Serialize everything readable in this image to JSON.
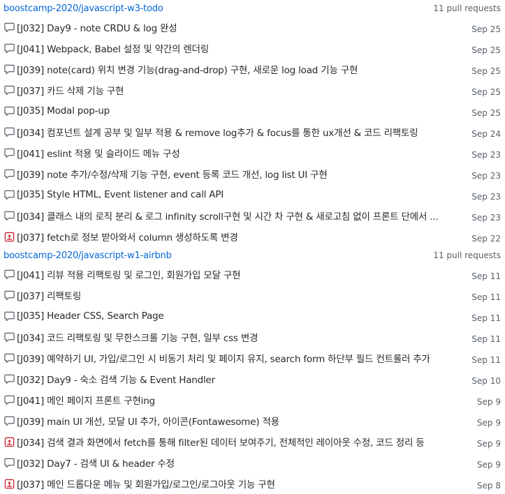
{
  "groups": [
    {
      "repo": "boostcamp-2020/javascript-w3-todo",
      "count": "11 pull requests",
      "items": [
        {
          "title": "[J032] Day9 - note CRDU & log 완성",
          "date": "Sep 25",
          "icon": "comment-icon"
        },
        {
          "title": "[J041] Webpack, Babel 설정 및 약간의 렌더링",
          "date": "Sep 25",
          "icon": "comment-icon"
        },
        {
          "title": "[J039] note(card) 위치 변경 기능(drag-and-drop) 구현, 새로운 log load 기능 구현",
          "date": "Sep 25",
          "icon": "comment-icon"
        },
        {
          "title": "[J037] 카드 삭제 기능 구현",
          "date": "Sep 25",
          "icon": "comment-icon"
        },
        {
          "title": "[J035] Modal pop-up",
          "date": "Sep 25",
          "icon": "comment-icon"
        },
        {
          "title": "[J034] 컴포넌트 설계 공부 및 일부 적용 & remove log추가 & focus를 통한 ux개선 & 코드 리팩토링",
          "date": "Sep 24",
          "icon": "comment-icon"
        },
        {
          "title": "[J041] eslint 적용 및 슬라이드 메뉴 구성",
          "date": "Sep 23",
          "icon": "comment-icon"
        },
        {
          "title": "[J039] note 추가/수정/삭제 기능 구현, event 등록 코드 개선, log list UI 구현",
          "date": "Sep 23",
          "icon": "comment-icon"
        },
        {
          "title": "[J035] Style HTML, Event listener and call API",
          "date": "Sep 23",
          "icon": "comment-icon"
        },
        {
          "title": "[J034] 클래스 내의 로직 분리 & 로그 infinity scroll구현 및 시간 차 구현 & 새로고침 없이 프론트 단에서 ...",
          "date": "Sep 23",
          "icon": "comment-icon"
        },
        {
          "title": "[J037] fetch로 정보 받아와서 column 생성하도록 변경",
          "date": "Sep 22",
          "icon": "pull-request-icon"
        }
      ]
    },
    {
      "repo": "boostcamp-2020/javascript-w1-airbnb",
      "count": "11 pull requests",
      "items": [
        {
          "title": "[J041] 리뷰 적용 리팩토링 및 로그인, 회원가입 모달 구현",
          "date": "Sep 11",
          "icon": "comment-icon"
        },
        {
          "title": "[J037] 리팩토링",
          "date": "Sep 11",
          "icon": "comment-icon"
        },
        {
          "title": "[J035] Header CSS, Search Page",
          "date": "Sep 11",
          "icon": "comment-icon"
        },
        {
          "title": "[J034] 코드 리팩토링 및 무한스크롤 기능 구현, 일부 css 변경",
          "date": "Sep 11",
          "icon": "comment-icon"
        },
        {
          "title": "[J039] 예약하기 UI, 가입/로그인 시 비동기 처리 및 페이지 유지, search form 하단부 필드 컨트롤러 추가",
          "date": "Sep 11",
          "icon": "comment-icon"
        },
        {
          "title": "[J032] Day9 - 숙소 검색 기능 & Event Handler",
          "date": "Sep 10",
          "icon": "comment-icon"
        },
        {
          "title": "[J041] 메인 페이지 프론트 구현ing",
          "date": "Sep 9",
          "icon": "comment-icon"
        },
        {
          "title": "[J039] main UI 개선, 모달 UI 추가, 아이콘(Fontawesome) 적용",
          "date": "Sep 9",
          "icon": "comment-icon"
        },
        {
          "title": "[J034] 검색 결과 화면에서 fetch를 통해 filter된 데이터 보여주기, 전체적인 레이아웃 수정, 코드 정리 등",
          "date": "Sep 9",
          "icon": "pull-request-icon"
        },
        {
          "title": "[J032] Day7 - 검색 UI & header 수정",
          "date": "Sep 9",
          "icon": "comment-icon"
        },
        {
          "title": "[J037] 메인 드롭다운 메뉴 및 회원가입/로그인/로그아웃 기능 구현",
          "date": "Sep 8",
          "icon": "pull-request-icon"
        }
      ]
    }
  ],
  "colors": {
    "link": "#0366d6",
    "icon_gray": "#586069",
    "icon_red": "#cb2431"
  }
}
